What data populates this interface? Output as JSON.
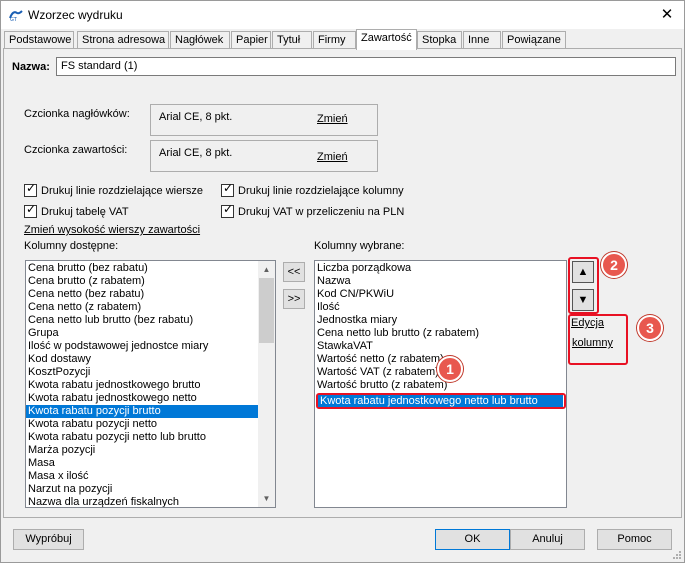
{
  "window": {
    "title": "Wzorzec wydruku",
    "close_symbol": "✕"
  },
  "tabs": [
    {
      "label": "Podstawowe"
    },
    {
      "label": "Strona adresowa"
    },
    {
      "label": "Nagłówek"
    },
    {
      "label": "Papier"
    },
    {
      "label": "Tytuł"
    },
    {
      "label": "Firmy"
    },
    {
      "label": "Zawartość"
    },
    {
      "label": "Stopka"
    },
    {
      "label": "Inne"
    },
    {
      "label": "Powiązane"
    }
  ],
  "active_tab": "Zawartość",
  "name": {
    "label": "Nazwa:",
    "value": "FS standard (1)"
  },
  "fonts": {
    "header_label": "Czcionka nagłówków:",
    "header_value": "Arial CE, 8 pkt.",
    "content_label": "Czcionka zawartości:",
    "content_value": "Arial CE, 8 pkt.",
    "change_label": "Zmień"
  },
  "checkboxes": [
    {
      "label": "Drukuj linie rozdzielające wiersze",
      "checked": true
    },
    {
      "label": "Drukuj linie rozdzielające kolumny",
      "checked": true
    },
    {
      "label": "Drukuj tabelę VAT",
      "checked": true
    },
    {
      "label": "Drukuj VAT w przeliczeniu na PLN",
      "checked": true
    }
  ],
  "row_height_link": "Zmień wysokość wierszy zawartości",
  "available": {
    "label": "Kolumny dostępne:",
    "items": [
      "Cena brutto (bez rabatu)",
      "Cena brutto (z rabatem)",
      "Cena netto (bez rabatu)",
      "Cena netto (z rabatem)",
      "Cena netto lub brutto (bez rabatu)",
      "Grupa",
      "Ilość w podstawowej jednostce miary",
      "Kod dostawy",
      "KosztPozycji",
      "Kwota rabatu jednostkowego brutto",
      "Kwota rabatu jednostkowego netto",
      "Kwota rabatu pozycji brutto",
      "Kwota rabatu pozycji netto",
      "Kwota rabatu pozycji netto lub brutto",
      "Marża pozycji",
      "Masa",
      "Masa x ilość",
      "Narzut na pozycji",
      "Nazwa dla urządzeń fiskalnych"
    ],
    "selected_index": 11
  },
  "move": {
    "left": "<<",
    "right": ">>"
  },
  "chosen": {
    "label": "Kolumny wybrane:",
    "items": [
      "Liczba porządkowa",
      "Nazwa",
      "Kod CN/PKWiU",
      "Ilość",
      "Jednostka miary",
      "Cena netto lub brutto (z rabatem)",
      "StawkaVAT",
      "Wartość netto (z rabatem)",
      "Wartość VAT (z rabatem)",
      "Wartość brutto (z rabatem)",
      "Kwota rabatu jednostkowego netto lub brutto"
    ],
    "selected_index": 10
  },
  "order": {
    "up_symbol": "▲",
    "down_symbol": "▼"
  },
  "edit_columns": {
    "line1": "Edycja",
    "line2": "kolumny"
  },
  "callouts": {
    "one": "1",
    "two": "2",
    "three": "3"
  },
  "buttons": {
    "try": "Wypróbuj",
    "ok": "OK",
    "cancel": "Anuluj",
    "help": "Pomoc"
  },
  "colors": {
    "selection": "#0078d7",
    "callout": "#e8584f",
    "highlight_frame": "#e81123"
  }
}
